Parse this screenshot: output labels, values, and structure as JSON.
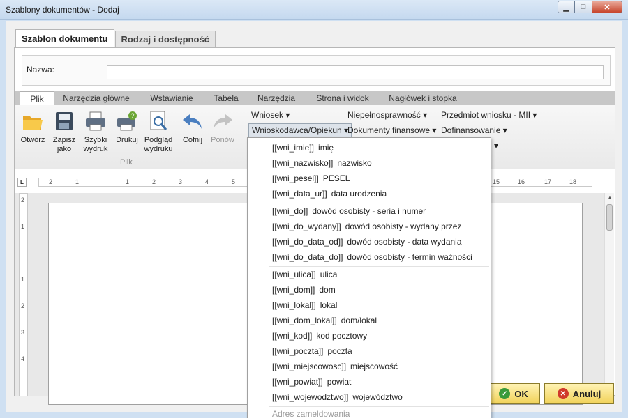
{
  "window": {
    "title": "Szablony dokumentów - Dodaj",
    "min": "▁",
    "max": "□",
    "close": "✕"
  },
  "tabs": [
    {
      "label": "Szablon dokumentu",
      "active": true
    },
    {
      "label": "Rodzaj i dostępność",
      "active": false
    }
  ],
  "name_field": {
    "label": "Nazwa:",
    "value": ""
  },
  "ribbon": {
    "tabs": [
      {
        "label": "Plik",
        "active": true
      },
      {
        "label": "Narzędzia główne"
      },
      {
        "label": "Wstawianie"
      },
      {
        "label": "Tabela"
      },
      {
        "label": "Narzędzia"
      },
      {
        "label": "Strona i widok"
      },
      {
        "label": "Nagłówek i stopka"
      }
    ],
    "buttons": [
      {
        "line1": "Otwórz",
        "line2": "",
        "icon": "folder-icon"
      },
      {
        "line1": "Zapisz",
        "line2": "jako",
        "icon": "save-icon"
      },
      {
        "line1": "Szybki",
        "line2": "wydruk",
        "icon": "quick-print-icon"
      },
      {
        "line1": "Drukuj",
        "line2": "",
        "icon": "print-icon"
      },
      {
        "line1": "Podgląd",
        "line2": "wydruku",
        "icon": "print-preview-icon"
      },
      {
        "line1": "Cofnij",
        "line2": "",
        "icon": "undo-icon"
      },
      {
        "line1": "Ponów",
        "line2": "",
        "icon": "redo-icon"
      }
    ],
    "group_label": "Plik",
    "dropdowns": [
      {
        "label": "Wniosek"
      },
      {
        "label": "Niepełnosprawność"
      },
      {
        "label": "Przedmiot wniosku - MII"
      },
      {
        "label": "Wnioskodawca/Opiekun"
      },
      {
        "label": "Dokumenty finansowe"
      },
      {
        "label": "Dofinansowanie"
      }
    ],
    "dropdown_arrow": "▾"
  },
  "ruler": {
    "corner": "L",
    "h_numbers": [
      "2",
      "1",
      "1",
      "2",
      "3",
      "4",
      "5",
      "15",
      "16",
      "17",
      "18"
    ],
    "v_numbers": [
      "2",
      "1",
      "1",
      "2",
      "3",
      "4"
    ]
  },
  "menu": {
    "groups": [
      [
        {
          "code": "[[wni_imie]]",
          "label": "imię"
        },
        {
          "code": "[[wni_nazwisko]]",
          "label": "nazwisko"
        },
        {
          "code": "[[wni_pesel]]",
          "label": "PESEL"
        },
        {
          "code": "[[wni_data_ur]]",
          "label": "data urodzenia"
        }
      ],
      [
        {
          "code": "[[wni_do]]",
          "label": "dowód osobisty - seria i numer"
        },
        {
          "code": "[[wni_do_wydany]]",
          "label": "dowód osobisty - wydany przez"
        },
        {
          "code": "[[wni_do_data_od]]",
          "label": "dowód osobisty - data wydania"
        },
        {
          "code": "[[wni_do_data_do]]",
          "label": "dowód osobisty - termin ważności"
        }
      ],
      [
        {
          "code": "[[wni_ulica]]",
          "label": "ulica"
        },
        {
          "code": "[[wni_dom]]",
          "label": "dom"
        },
        {
          "code": "[[wni_lokal]]",
          "label": "lokal"
        },
        {
          "code": "[[wni_dom_lokal]]",
          "label": "dom/lokal"
        },
        {
          "code": "[[wni_kod]]",
          "label": "kod pocztowy"
        },
        {
          "code": "[[wni_poczta]]",
          "label": "poczta"
        },
        {
          "code": "[[wni_miejscowosc]]",
          "label": "miejscowość"
        },
        {
          "code": "[[wni_powiat]]",
          "label": "powiat"
        },
        {
          "code": "[[wni_wojewodztwo]]",
          "label": "województwo"
        }
      ]
    ],
    "section_header": "Adres zameldowania"
  },
  "footer": {
    "ok_label": "OK",
    "cancel_label": "Anuluj",
    "ok_icon": "ok-icon",
    "cancel_icon": "cancel-icon"
  },
  "colors": {
    "title_bar": "#c5d9ef",
    "button_gradient": "#f1d25a",
    "ok_icon": "#3a9a3a",
    "cancel_icon": "#d0392b"
  }
}
